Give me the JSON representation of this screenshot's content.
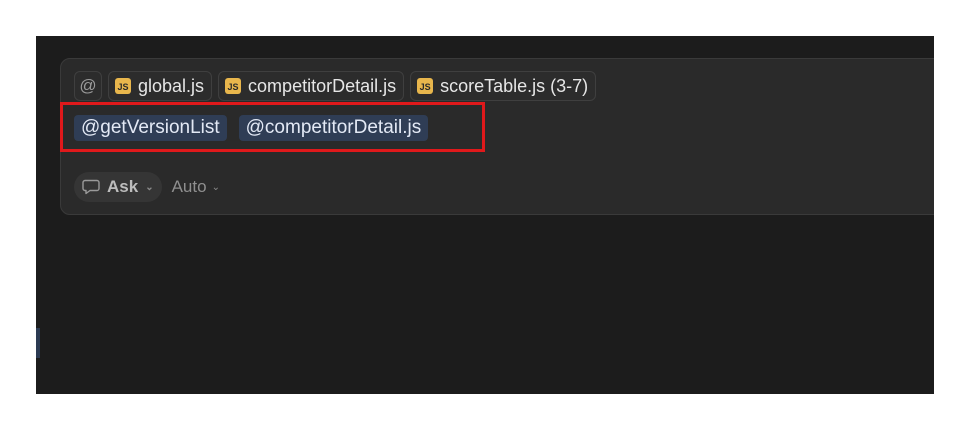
{
  "context": {
    "at_symbol": "@",
    "files": [
      {
        "icon": "js-file-icon",
        "icon_text": "JS",
        "name": "global.js"
      },
      {
        "icon": "js-file-icon",
        "icon_text": "JS",
        "name": "competitorDetail.js"
      },
      {
        "icon": "js-file-icon",
        "icon_text": "JS",
        "name": "scoreTable.js (3-7)"
      }
    ]
  },
  "mentions": [
    "@getVersionList",
    "@competitorDetail.js"
  ],
  "mode": {
    "ask_label": "Ask",
    "auto_label": "Auto"
  },
  "colors": {
    "background": "#1c1c1c",
    "panel": "#2a2a2a",
    "mention": "#2f3d55",
    "js_icon": "#e8b64c",
    "highlight": "#e0191b"
  }
}
